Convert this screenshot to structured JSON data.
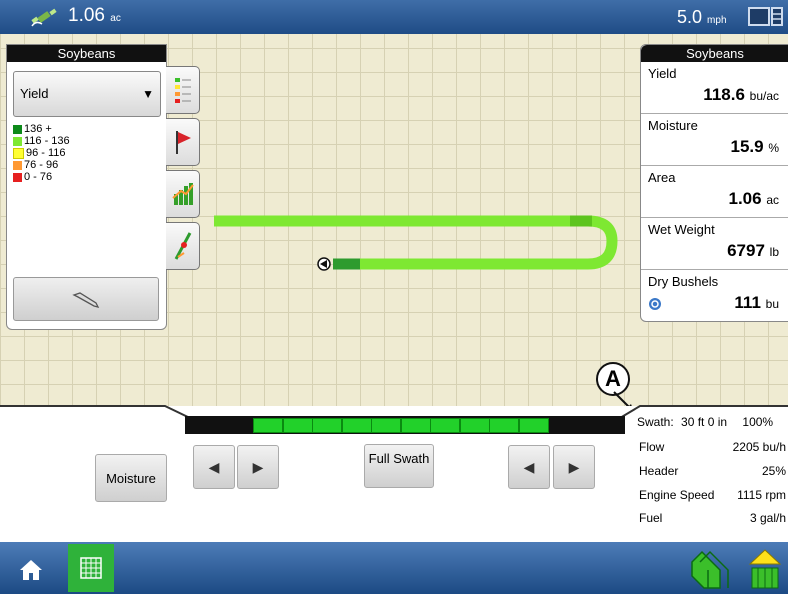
{
  "topbar": {
    "area_value": "1.06",
    "area_unit": "ac",
    "speed_value": "5.0",
    "speed_unit": "mph"
  },
  "left_panel": {
    "title": "Soybeans",
    "layer_select": "Yield",
    "legend": [
      {
        "label": "136 +",
        "color": "#0d8a1a"
      },
      {
        "label": "116 - 136",
        "color": "#7ee832"
      },
      {
        "label": "96 - 116",
        "color": "#ffff33"
      },
      {
        "label": "76 - 96",
        "color": "#ff9933"
      },
      {
        "label": "0 - 76",
        "color": "#e62020"
      }
    ],
    "tabs": [
      "legend-icon",
      "flag-icon",
      "bar-chart-icon",
      "guidance-icon"
    ]
  },
  "right_panel": {
    "title": "Soybeans",
    "metrics": [
      {
        "label": "Yield",
        "value": "118.6",
        "unit": "bu/ac"
      },
      {
        "label": "Moisture",
        "value": "15.9",
        "unit": "%"
      },
      {
        "label": "Area",
        "value": "1.06",
        "unit": "ac"
      },
      {
        "label": "Wet Weight",
        "value": "6797",
        "unit": "lb"
      },
      {
        "label": "Dry Bushels",
        "value": "111",
        "unit": "bu"
      }
    ]
  },
  "callout": "A",
  "swath": {
    "label": "Swath:",
    "width": "30 ft 0 in",
    "percent": "100%",
    "active_sections": 10
  },
  "controls": {
    "moisture_button": "Moisture",
    "full_swath_button": "Full Swath"
  },
  "stats": [
    {
      "label": "Flow",
      "value": "2205 bu/h"
    },
    {
      "label": "Header",
      "value": "25%"
    },
    {
      "label": "Engine Speed",
      "value": "1115 rpm"
    },
    {
      "label": "Fuel",
      "value": "3 gal/h"
    }
  ],
  "colors": {
    "accent_green": "#22d12a",
    "path_green": "#7ee832",
    "topbar_blue": "#2a5a96"
  }
}
